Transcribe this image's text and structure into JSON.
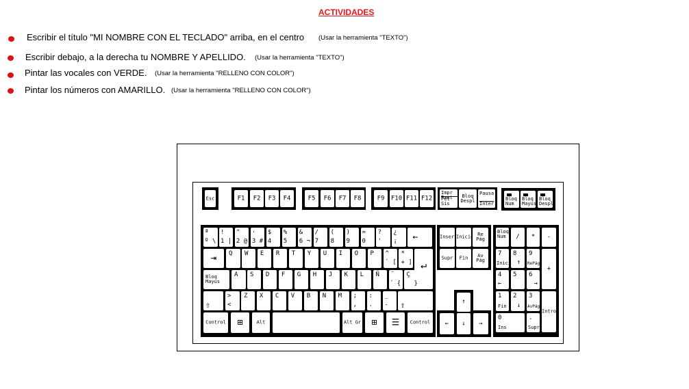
{
  "title": "ACTIVIDADES",
  "accent_color": "#e8141b",
  "tasks": [
    {
      "main": "Escribir el título  \"MI NOMBRE CON EL TECLADO\"   arriba, en el centro",
      "hint": "(Usar la herramienta \"TEXTO\")"
    },
    {
      "main": "Escribir debajo, a la derecha tu NOMBRE Y APELLIDO.",
      "hint": "(Usar la herramienta \"TEXTO\")"
    },
    {
      "main": "Pintar las vocales con VERDE.",
      "hint": "(Usar la herramienta \"RELLENO CON COLOR\")"
    },
    {
      "main": "Pintar los números con AMARILLO.",
      "hint": "(Usar la herramienta \"RELLENO CON COLOR\")"
    }
  ],
  "keyboard": {
    "esc": "Esc",
    "f1_4": [
      "F1",
      "F2",
      "F3",
      "F4"
    ],
    "f5_8": [
      "F5",
      "F6",
      "F7",
      "F8"
    ],
    "f9_12": [
      "F9",
      "F10",
      "F11",
      "F12"
    ],
    "sys": {
      "print_top": "Impr Pant",
      "print_bottom": "Pet Sis",
      "scroll": "Bloq Despl",
      "pause_top": "Pausa",
      "pause_bottom": "Inter"
    },
    "leds": [
      "Bloq Num",
      "Bloq Mayús",
      "Bloq Despl"
    ],
    "row1": [
      {
        "top": "ª",
        "bottom": "º \\"
      },
      {
        "top": "!",
        "bottom": "1 |"
      },
      {
        "top": "\"",
        "bottom": "2 @"
      },
      {
        "top": "·",
        "bottom": "3 #"
      },
      {
        "top": "$",
        "bottom": "4"
      },
      {
        "top": "%",
        "bottom": "5"
      },
      {
        "top": "&",
        "bottom": "6 ¬"
      },
      {
        "top": "/",
        "bottom": "7"
      },
      {
        "top": "(",
        "bottom": "8"
      },
      {
        "top": ")",
        "bottom": "9"
      },
      {
        "top": "=",
        "bottom": "0"
      },
      {
        "top": "?",
        "bottom": "'"
      },
      {
        "top": "¿",
        "bottom": "¡"
      }
    ],
    "backspace": "←",
    "tab": "⇥",
    "row2": [
      "Q",
      "W",
      "E",
      "R",
      "T",
      "Y",
      "U",
      "I",
      "O",
      "P"
    ],
    "row2_extra": [
      {
        "top": "^",
        "bottom": "` ["
      },
      {
        "top": "*",
        "bottom": "+ ]"
      }
    ],
    "enter": "↵",
    "caps": "Bloq Mayús",
    "row3": [
      "A",
      "S",
      "D",
      "F",
      "G",
      "H",
      "J",
      "K",
      "L",
      "Ñ"
    ],
    "row3_extra": [
      {
        "top": "¨",
        "bottom": "´ {"
      },
      {
        "top": "Ç",
        "bottom": "}"
      }
    ],
    "shift": "⇧",
    "row4_lt": {
      "top": ">",
      "bottom": "<"
    },
    "row4": [
      "Z",
      "X",
      "C",
      "V",
      "B",
      "N",
      "M"
    ],
    "row4_extra": [
      {
        "top": ";",
        "bottom": ","
      },
      {
        "top": ":",
        "bottom": "."
      },
      {
        "top": "_",
        "bottom": "-"
      }
    ],
    "control": "Control",
    "alt": "Alt",
    "altgr": "Alt Gr",
    "nav": [
      "Insert",
      "Inicio",
      "Re Pág",
      "Supr",
      "Fin",
      "Av Pág"
    ],
    "arrows": {
      "up": "↑",
      "left": "←",
      "down": "↓",
      "right": "→"
    },
    "numpad": {
      "numlock": "Bloq Num",
      "div": "/",
      "mul": "*",
      "minus": "-",
      "plus": "+",
      "enter": "Intro",
      "n7": "7",
      "n7s": "Inicio",
      "n8": "8",
      "n8s": "↑",
      "n9": "9",
      "n9s": "RePág",
      "n4": "4",
      "n4s": "←",
      "n5": "5",
      "n6": "6",
      "n6s": "→",
      "n1": "1",
      "n1s": "Fin",
      "n2": "2",
      "n2s": "↓",
      "n3": "3",
      "n3s": "AvPág",
      "n0": "0",
      "n0s": "Ins",
      "dot": ".",
      "dots": "Supr"
    }
  }
}
